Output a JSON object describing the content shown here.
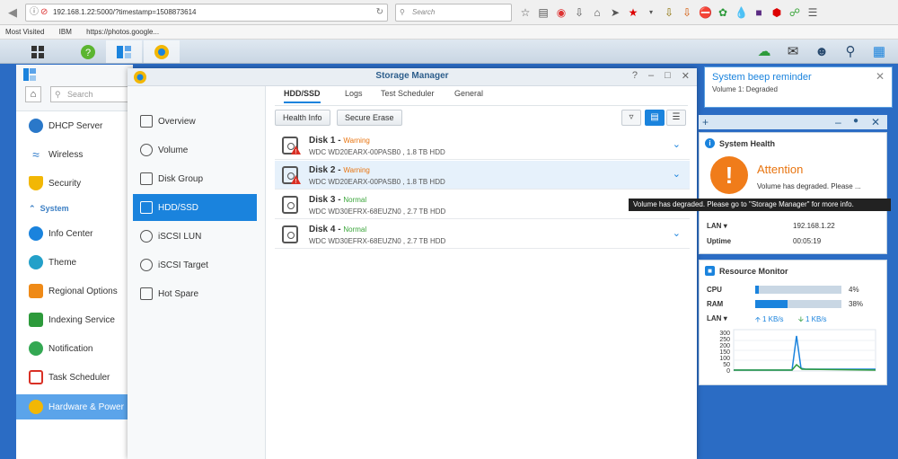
{
  "browser": {
    "url": "192.168.1.22:5000/?timestamp=1508873614",
    "search_placeholder": "Search",
    "bookmarks": [
      "Most Visited",
      "IBM",
      "https://photos.google..."
    ]
  },
  "control_panel": {
    "search_placeholder": "Search",
    "items": [
      {
        "label": "DHCP Server",
        "color": "#2a78c9"
      },
      {
        "label": "Wireless",
        "color": "#2a78c9"
      },
      {
        "label": "Security",
        "color": "#f2b705"
      }
    ],
    "section": "System",
    "system_items": [
      {
        "label": "Info Center",
        "color": "#1a83dd"
      },
      {
        "label": "Theme",
        "color": "#23a0c9"
      },
      {
        "label": "Regional Options",
        "color": "#ef8a17"
      },
      {
        "label": "Indexing Service",
        "color": "#2d9a3b"
      },
      {
        "label": "Notification",
        "color": "#34a853"
      },
      {
        "label": "Task Scheduler",
        "color": "#d93025"
      },
      {
        "label": "Hardware & Power",
        "color": "#f2b705"
      }
    ]
  },
  "storage_manager": {
    "title": "Storage Manager",
    "sidebar": [
      "Overview",
      "Volume",
      "Disk Group",
      "HDD/SSD",
      "iSCSI LUN",
      "iSCSI Target",
      "Hot Spare"
    ],
    "tabs": [
      "HDD/SSD",
      "Logs",
      "Test Scheduler",
      "General"
    ],
    "buttons": {
      "health_info": "Health Info",
      "secure_erase": "Secure Erase"
    },
    "disks": [
      {
        "name": "Disk 1",
        "status": "Warning",
        "status_color": "#e8740f",
        "model": "WDC WD20EARX-00PASB0 , 1.8 TB HDD",
        "warn": true
      },
      {
        "name": "Disk 2",
        "status": "Warning",
        "status_color": "#e8740f",
        "model": "WDC WD20EARX-00PASB0 , 1.8 TB HDD",
        "warn": true
      },
      {
        "name": "Disk 3",
        "status": "Normal",
        "status_color": "#3aa53a",
        "model": "WDC WD30EFRX-68EUZN0 , 2.7 TB HDD",
        "warn": false
      },
      {
        "name": "Disk 4",
        "status": "Normal",
        "status_color": "#3aa53a",
        "model": "WDC WD30EFRX-68EUZN0 , 2.7 TB HDD",
        "warn": false
      }
    ]
  },
  "notification": {
    "title": "System beep reminder",
    "subtitle": "Volume 1: Degraded"
  },
  "system_health": {
    "title": "System Health",
    "attention": "Attention",
    "message": "Volume has degraded. Please ...",
    "lan_label": "LAN",
    "lan_value": "192.168.1.22",
    "uptime_label": "Uptime",
    "uptime_value": "00:05:19"
  },
  "resource_monitor": {
    "title": "Resource Monitor",
    "cpu_label": "CPU",
    "cpu_pct": 4,
    "cpu_text": "4%",
    "ram_label": "RAM",
    "ram_pct": 38,
    "ram_text": "38%",
    "lan_label": "LAN",
    "lan_up": "1 KB/s",
    "lan_down": "1 KB/s",
    "chart_ticks": [
      "300",
      "250",
      "200",
      "150",
      "100",
      "50",
      "0"
    ]
  },
  "tooltip": "Volume has degraded. Please go to \"Storage Manager\" for more info."
}
